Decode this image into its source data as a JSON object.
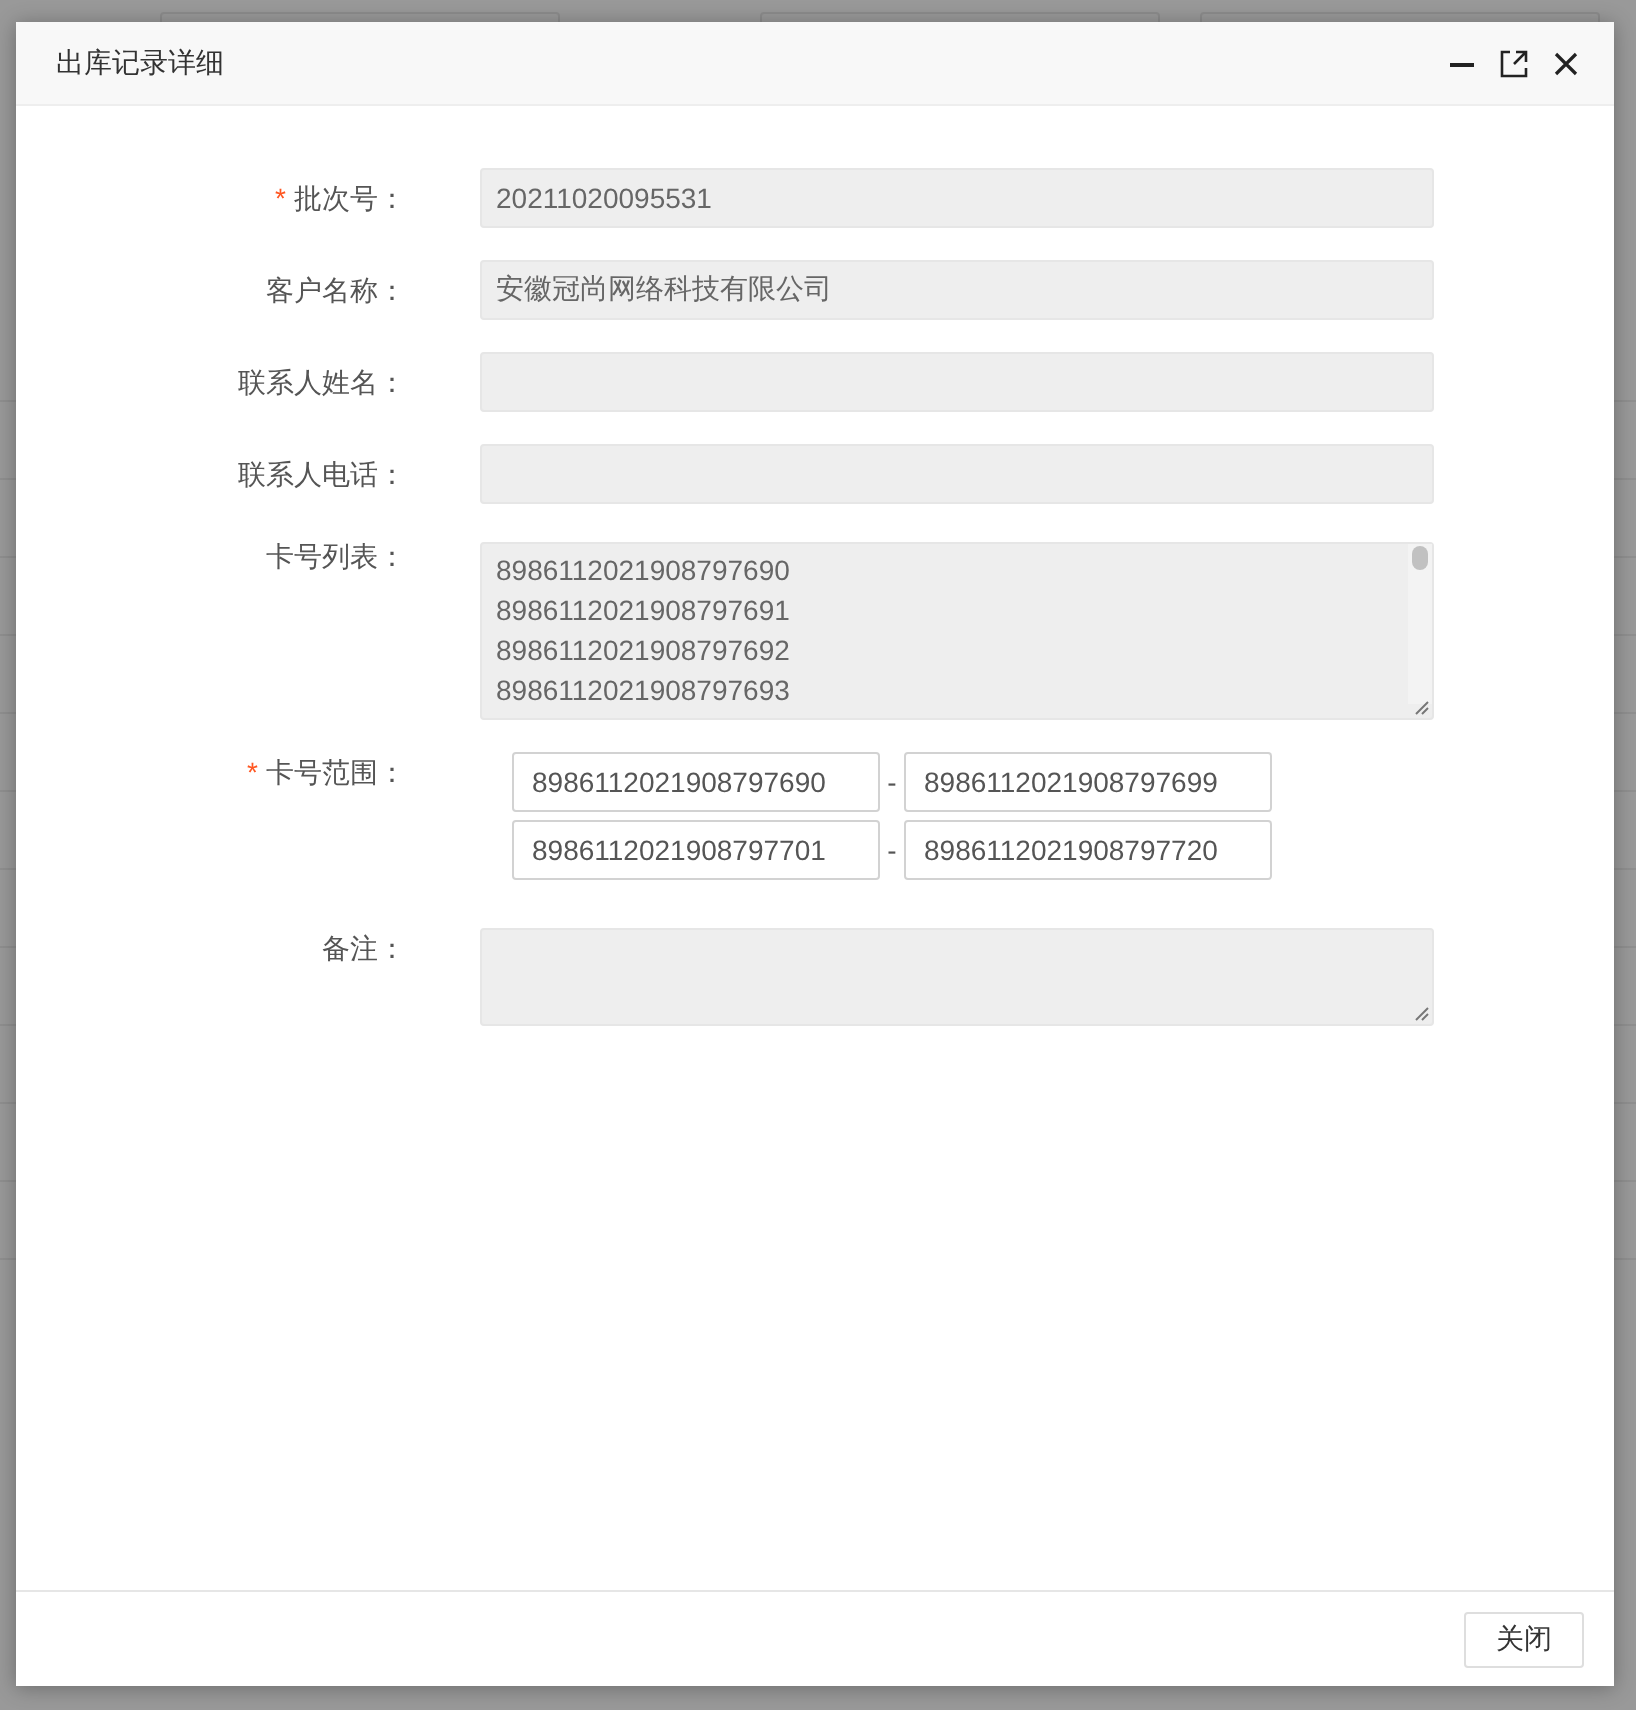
{
  "dialog": {
    "title": "出库记录详细",
    "fields": [
      {
        "kind": "input",
        "required_mark": "*",
        "label": "批次号：",
        "disabled": true,
        "value": "20211020095531"
      },
      {
        "kind": "input",
        "label": "客户名称：",
        "disabled": true,
        "value": "安徽冠尚网络科技有限公司"
      },
      {
        "kind": "input",
        "label": "联系人姓名：",
        "disabled": true
      },
      {
        "kind": "input",
        "label": "联系人电话：",
        "disabled": true
      },
      {
        "kind": "textarea",
        "label": "卡号列表：",
        "disabled": true,
        "lines": [
          "8986112021908797690",
          "8986112021908797691",
          "8986112021908797692",
          "8986112021908797693"
        ]
      },
      {
        "kind": "range",
        "required_mark": "*",
        "label": "卡号范围：",
        "disabled": false,
        "ranges": [
          {
            "from": "8986112021908797690",
            "separator": "-",
            "to": "8986112021908797699"
          },
          {
            "from": "8986112021908797701",
            "separator": "-",
            "to": "8986112021908797720"
          }
        ]
      },
      {
        "kind": "textarea",
        "label": "备注：",
        "disabled": true
      }
    ],
    "footer_button": "关闭"
  }
}
